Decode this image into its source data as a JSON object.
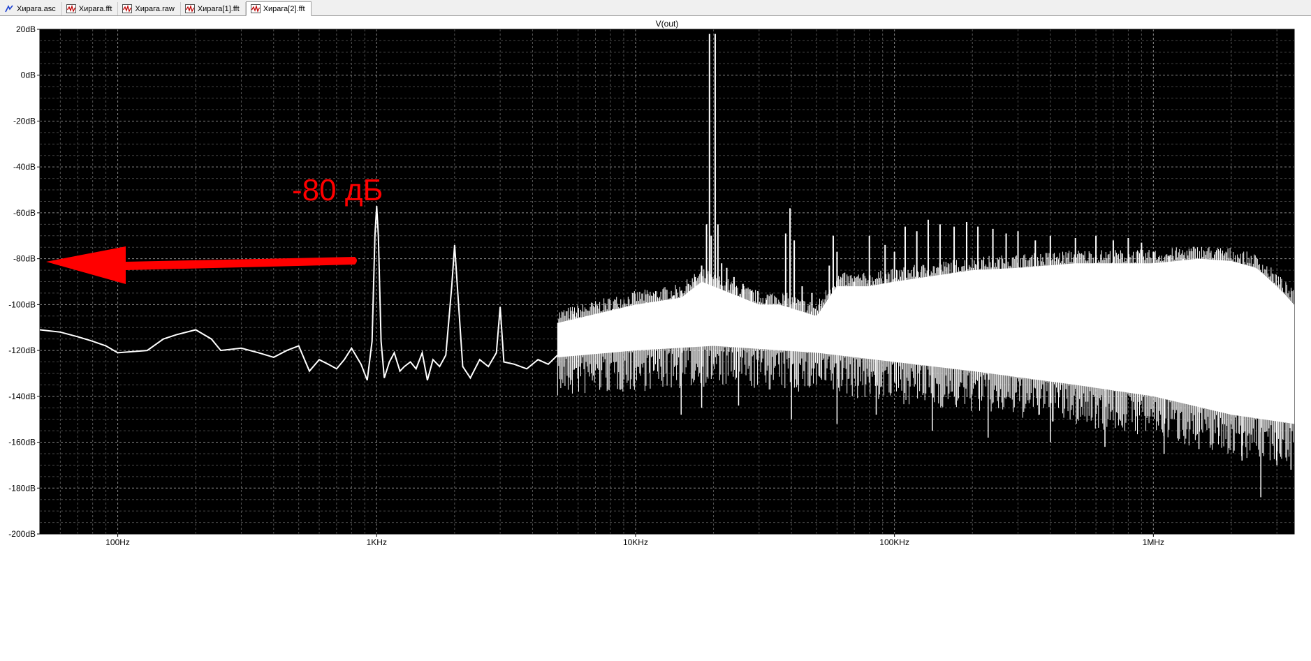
{
  "tabs": [
    {
      "label": "Хирага.asc",
      "icon": "schematic-icon",
      "active": false
    },
    {
      "label": "Хирага.fft",
      "icon": "waveform-icon",
      "active": false
    },
    {
      "label": "Хирага.raw",
      "icon": "waveform-icon",
      "active": false
    },
    {
      "label": "Хирага[1].fft",
      "icon": "waveform-icon",
      "active": false
    },
    {
      "label": "Хирага[2].fft",
      "icon": "waveform-icon",
      "active": true
    }
  ],
  "annotation": {
    "text": "-80 дБ",
    "color": "#ff0000"
  },
  "chart_data": {
    "type": "line",
    "title": "V(out)",
    "x_scale": "log",
    "xlim": [
      50,
      3500000
    ],
    "ylim": [
      -200,
      20
    ],
    "grid": true,
    "x_tick_labels": [
      "100Hz",
      "1KHz",
      "10KHz",
      "100KHz",
      "1MHz"
    ],
    "x_tick_values": [
      100,
      1000,
      10000,
      100000,
      1000000
    ],
    "y_tick_labels": [
      "20dB",
      "0dB",
      "-20dB",
      "-40dB",
      "-60dB",
      "-80dB",
      "-100dB",
      "-120dB",
      "-140dB",
      "-160dB",
      "-180dB",
      "-200dB"
    ],
    "y_tick_values": [
      20,
      0,
      -20,
      -40,
      -60,
      -80,
      -100,
      -120,
      -140,
      -160,
      -180,
      -200
    ],
    "series": [
      {
        "color": "#ffffff",
        "points": [
          [
            50,
            -111
          ],
          [
            60,
            -112
          ],
          [
            70,
            -114
          ],
          [
            80,
            -116
          ],
          [
            90,
            -118
          ],
          [
            100,
            -121
          ],
          [
            130,
            -120
          ],
          [
            150,
            -115
          ],
          [
            170,
            -113
          ],
          [
            200,
            -111
          ],
          [
            230,
            -115
          ],
          [
            250,
            -120
          ],
          [
            300,
            -119
          ],
          [
            350,
            -121
          ],
          [
            400,
            -123
          ],
          [
            450,
            -120
          ],
          [
            500,
            -118
          ],
          [
            550,
            -129
          ],
          [
            600,
            -124
          ],
          [
            650,
            -126
          ],
          [
            700,
            -128
          ],
          [
            750,
            -124
          ],
          [
            800,
            -119
          ],
          [
            870,
            -126
          ],
          [
            920,
            -133
          ],
          [
            960,
            -116
          ],
          [
            985,
            -70
          ],
          [
            1000,
            -57
          ],
          [
            1015,
            -70
          ],
          [
            1040,
            -116
          ],
          [
            1070,
            -132
          ],
          [
            1120,
            -125
          ],
          [
            1170,
            -121
          ],
          [
            1230,
            -129
          ],
          [
            1280,
            -127
          ],
          [
            1350,
            -125
          ],
          [
            1420,
            -128
          ],
          [
            1500,
            -121
          ],
          [
            1570,
            -133
          ],
          [
            1650,
            -124
          ],
          [
            1750,
            -127
          ],
          [
            1850,
            -122
          ],
          [
            1950,
            -92
          ],
          [
            2000,
            -74
          ],
          [
            2050,
            -92
          ],
          [
            2150,
            -127
          ],
          [
            2300,
            -132
          ],
          [
            2500,
            -124
          ],
          [
            2700,
            -127
          ],
          [
            2900,
            -121
          ],
          [
            3000,
            -101
          ],
          [
            3100,
            -125
          ],
          [
            3400,
            -126
          ],
          [
            3800,
            -128
          ],
          [
            4200,
            -124
          ],
          [
            4600,
            -126
          ],
          [
            5000,
            -122
          ]
        ]
      }
    ],
    "spectrum_tail": {
      "description_free": true,
      "floor": [
        [
          5000,
          -123
        ],
        [
          10000,
          -120
        ],
        [
          20000,
          -118
        ],
        [
          50000,
          -121
        ],
        [
          100000,
          -125
        ],
        [
          200000,
          -129
        ],
        [
          500000,
          -135
        ],
        [
          1000000,
          -140
        ],
        [
          2000000,
          -148
        ],
        [
          3500000,
          -152
        ]
      ],
      "upper_envelope": [
        [
          5000,
          -108
        ],
        [
          10000,
          -100
        ],
        [
          15000,
          -97
        ],
        [
          18000,
          -90
        ],
        [
          30000,
          -100
        ],
        [
          36000,
          -100
        ],
        [
          50000,
          -105
        ],
        [
          60000,
          -92
        ],
        [
          80000,
          -92
        ],
        [
          100000,
          -90
        ],
        [
          200000,
          -85
        ],
        [
          300000,
          -84
        ],
        [
          500000,
          -82
        ],
        [
          800000,
          -82
        ],
        [
          1000000,
          -82
        ],
        [
          1500000,
          -80
        ],
        [
          2000000,
          -81
        ],
        [
          2500000,
          -84
        ],
        [
          3000000,
          -92
        ],
        [
          3500000,
          -100
        ]
      ],
      "peaks": [
        [
          5800,
          -103
        ],
        [
          7000,
          -104
        ],
        [
          8200,
          -102
        ],
        [
          9200,
          -101
        ],
        [
          10000,
          -100
        ],
        [
          11000,
          -99
        ],
        [
          12000,
          -99
        ],
        [
          13000,
          -98
        ],
        [
          14000,
          -96
        ],
        [
          15000,
          -94
        ],
        [
          16000,
          -91
        ],
        [
          17000,
          -88
        ],
        [
          18000,
          -83
        ],
        [
          18800,
          -65
        ],
        [
          19300,
          18
        ],
        [
          19600,
          -70
        ],
        [
          20300,
          18
        ],
        [
          20800,
          -65
        ],
        [
          21500,
          -82
        ],
        [
          22500,
          -84
        ],
        [
          24000,
          -88
        ],
        [
          26000,
          -91
        ],
        [
          28000,
          -94
        ],
        [
          32000,
          -98
        ],
        [
          36000,
          -101
        ],
        [
          38000,
          -69
        ],
        [
          39500,
          -58
        ],
        [
          41000,
          -72
        ],
        [
          44000,
          -92
        ],
        [
          48000,
          -95
        ],
        [
          56000,
          -83
        ],
        [
          58000,
          -70
        ],
        [
          60000,
          -77
        ],
        [
          70000,
          -90
        ],
        [
          80000,
          -70
        ],
        [
          92000,
          -74
        ],
        [
          100000,
          -77
        ],
        [
          110000,
          -66
        ],
        [
          122000,
          -68
        ],
        [
          135000,
          -63
        ],
        [
          150000,
          -65
        ],
        [
          170000,
          -66
        ],
        [
          190000,
          -64
        ],
        [
          210000,
          -66
        ],
        [
          240000,
          -67
        ],
        [
          270000,
          -69
        ],
        [
          300000,
          -68
        ],
        [
          350000,
          -72
        ],
        [
          400000,
          -70
        ],
        [
          500000,
          -71
        ],
        [
          600000,
          -70
        ],
        [
          700000,
          -72
        ],
        [
          800000,
          -71
        ],
        [
          900000,
          -73
        ],
        [
          1000000,
          -77
        ],
        [
          1150000,
          -79
        ],
        [
          1300000,
          -80
        ]
      ],
      "dips": [
        [
          15000,
          -148
        ],
        [
          18000,
          -145
        ],
        [
          25000,
          -144
        ],
        [
          40000,
          -150
        ],
        [
          60000,
          -152
        ],
        [
          85000,
          -148
        ],
        [
          140000,
          -155
        ],
        [
          230000,
          -158
        ],
        [
          400000,
          -160
        ],
        [
          650000,
          -162
        ],
        [
          1100000,
          -165
        ],
        [
          1500000,
          -163
        ],
        [
          2200000,
          -168
        ],
        [
          2600000,
          -184
        ],
        [
          3000000,
          -170
        ],
        [
          3400000,
          -172
        ]
      ]
    }
  }
}
